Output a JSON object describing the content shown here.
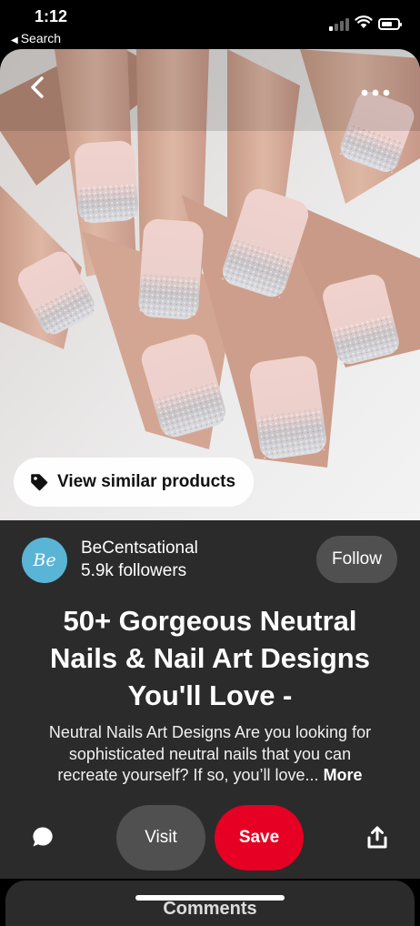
{
  "status_bar": {
    "time": "1:12",
    "back_app": "Search"
  },
  "photo": {
    "alt": "nails-photo"
  },
  "similar_products": {
    "label": "View similar products"
  },
  "creator": {
    "avatar_text": "Be",
    "name": "BeCentsational",
    "followers": "5.9k followers",
    "follow_label": "Follow"
  },
  "pin": {
    "title_lines": [
      "50+ Gorgeous Neutral",
      "Nails & Nail Art Designs",
      "You'll Love -"
    ],
    "description_lines": [
      "Neutral Nails Art Designs Are you looking for",
      "sophisticated neutral nails that you can"
    ],
    "description_last": "recreate yourself? If so, you’ll love...",
    "more_label": "More"
  },
  "actions": {
    "visit_label": "Visit",
    "save_label": "Save"
  },
  "comments": {
    "label": "Comments"
  },
  "colors": {
    "card_bg": "#2b2b2b",
    "save_red": "#e60023",
    "button_gray": "#505050",
    "avatar_blue": "#5ab4d6"
  }
}
